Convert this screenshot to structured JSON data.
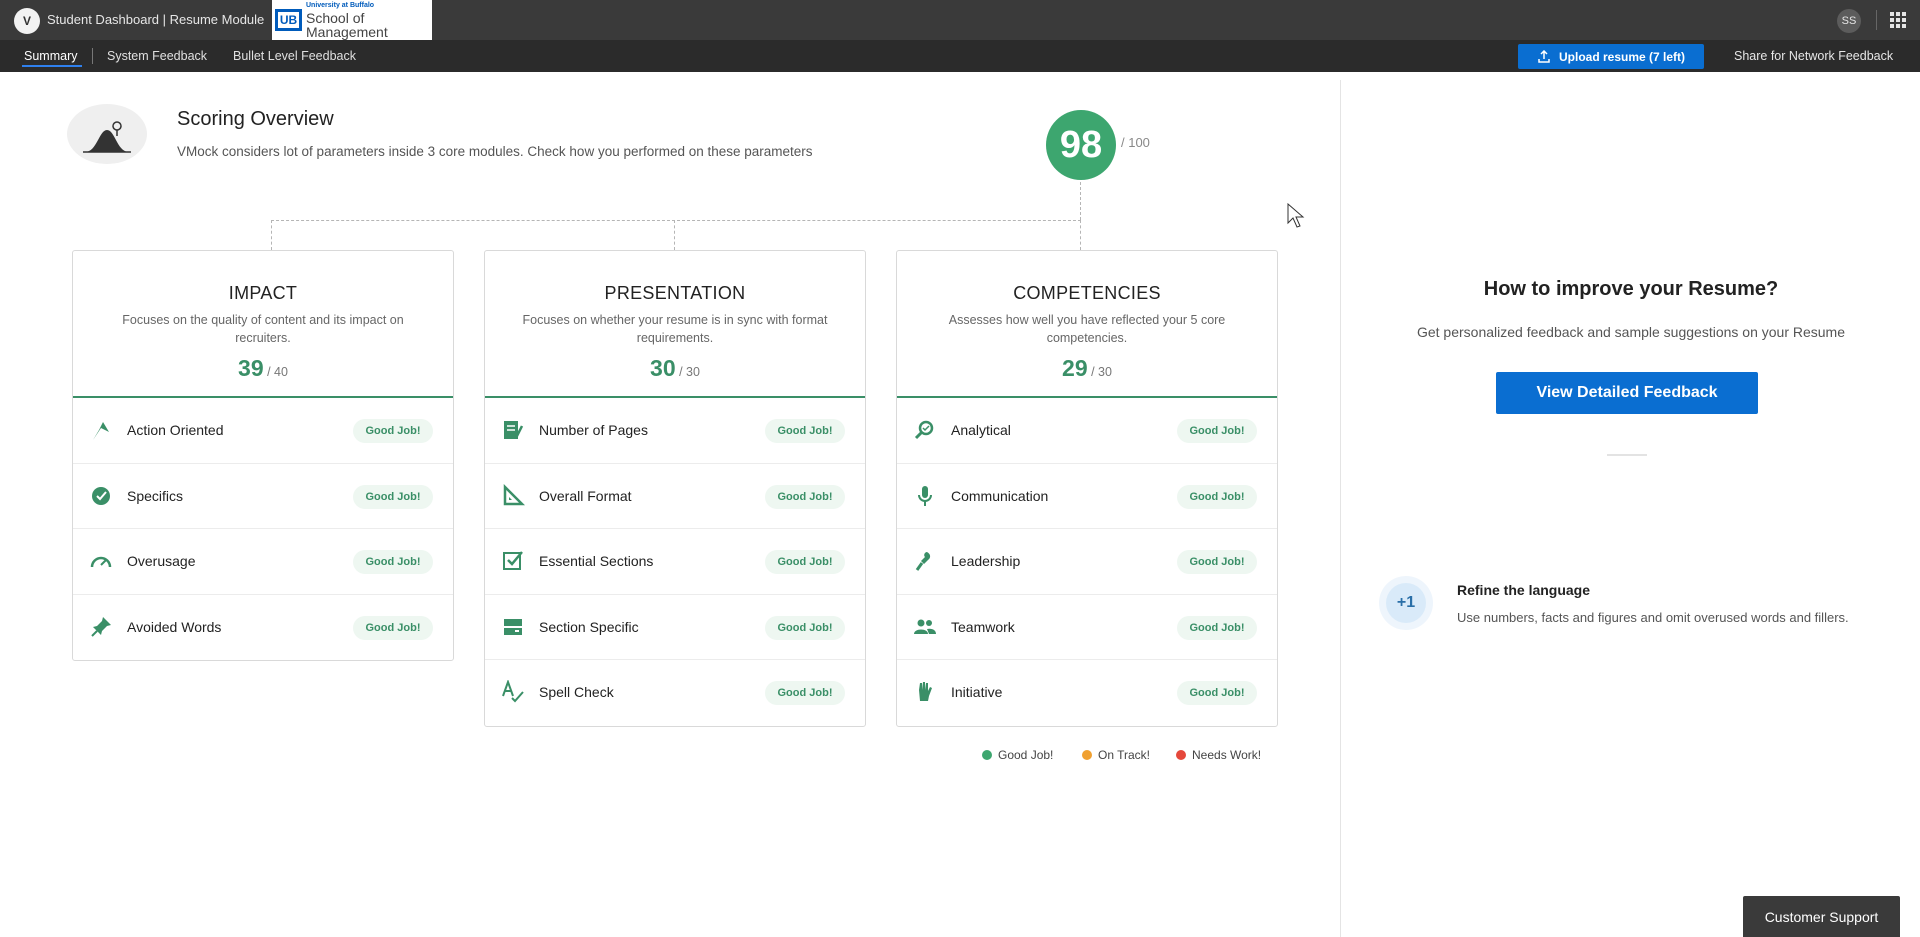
{
  "topbar": {
    "logo_letter": "V",
    "app_title": "Student Dashboard | Resume Module",
    "org_logo_small": "University at Buffalo",
    "org_logo_mark": "UB",
    "org_logo_big": "School of Management",
    "avatar_initials": "SS",
    "apps_icon": "grid-icon"
  },
  "subnav": {
    "tabs": [
      {
        "label": "Summary",
        "active": true
      },
      {
        "label": "System Feedback",
        "active": false
      },
      {
        "label": "Bullet Level Feedback",
        "active": false
      }
    ],
    "upload_label": "Upload resume (7 left)",
    "share_label": "Share for Network Feedback"
  },
  "overview": {
    "title": "Scoring Overview",
    "subtitle": "VMock considers lot of parameters inside 3 core modules. Check how you performed on these parameters",
    "score": "98",
    "score_total": "/ 100"
  },
  "modules": [
    {
      "title": "IMPACT",
      "desc": "Focuses on the quality of content and its impact on recruiters.",
      "score": "39",
      "total": "/ 40",
      "items": [
        {
          "label": "Action Oriented",
          "status": "Good Job!",
          "icon": "action-icon"
        },
        {
          "label": "Specifics",
          "status": "Good Job!",
          "icon": "target-icon"
        },
        {
          "label": "Overusage",
          "status": "Good Job!",
          "icon": "gauge-icon"
        },
        {
          "label": "Avoided Words",
          "status": "Good Job!",
          "icon": "pin-icon"
        }
      ]
    },
    {
      "title": "PRESENTATION",
      "desc": "Focuses on whether your resume is in sync with format requirements.",
      "score": "30",
      "total": "/ 30",
      "items": [
        {
          "label": "Number of Pages",
          "status": "Good Job!",
          "icon": "pages-icon"
        },
        {
          "label": "Overall Format",
          "status": "Good Job!",
          "icon": "ruler-icon"
        },
        {
          "label": "Essential Sections",
          "status": "Good Job!",
          "icon": "checkbox-icon"
        },
        {
          "label": "Section Specific",
          "status": "Good Job!",
          "icon": "sections-icon"
        },
        {
          "label": "Spell Check",
          "status": "Good Job!",
          "icon": "spellcheck-icon"
        }
      ]
    },
    {
      "title": "COMPETENCIES",
      "desc": "Assesses how well you have reflected your 5 core competencies.",
      "score": "29",
      "total": "/ 30",
      "items": [
        {
          "label": "Analytical",
          "status": "Good Job!",
          "icon": "magnifier-icon"
        },
        {
          "label": "Communication",
          "status": "Good Job!",
          "icon": "microphone-icon"
        },
        {
          "label": "Leadership",
          "status": "Good Job!",
          "icon": "torch-icon"
        },
        {
          "label": "Teamwork",
          "status": "Good Job!",
          "icon": "people-icon"
        },
        {
          "label": "Initiative",
          "status": "Good Job!",
          "icon": "hand-icon"
        }
      ]
    }
  ],
  "legend": [
    {
      "label": "Good Job!",
      "color": "#3da66f"
    },
    {
      "label": "On Track!",
      "color": "#f0a030"
    },
    {
      "label": "Needs Work!",
      "color": "#e5483b"
    }
  ],
  "right_panel": {
    "title": "How to improve your Resume?",
    "subtitle": "Get personalized feedback and sample suggestions on your Resume",
    "button": "View Detailed Feedback",
    "tip_badge": "+1",
    "tip_title": "Refine the language",
    "tip_text": "Use numbers, facts and figures and omit overused words and fillers."
  },
  "support_label": "Customer Support",
  "colors": {
    "accent_green": "#3a8f67",
    "primary_blue": "#0a6ed1",
    "topbar": "#3a3a3a"
  }
}
